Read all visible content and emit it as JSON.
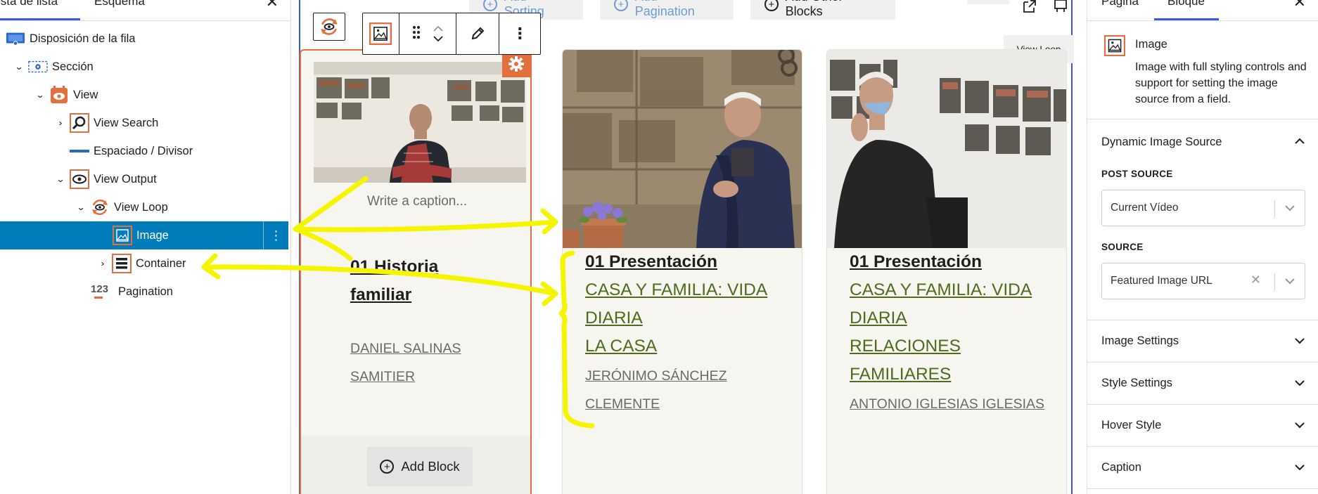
{
  "left_panel": {
    "tabs": [
      "Vista de lista",
      "Esquema"
    ],
    "tree": [
      {
        "label": "Disposición de la fila"
      },
      {
        "label": "Sección"
      },
      {
        "label": "View"
      },
      {
        "label": "View Search"
      },
      {
        "label": "Espaciado / Divisor"
      },
      {
        "label": "View Output"
      },
      {
        "label": "View Loop"
      },
      {
        "label": "Image"
      },
      {
        "label": "Container"
      },
      {
        "label": "Pagination"
      }
    ]
  },
  "canvas": {
    "top_buttons": [
      "Add Sorting",
      "Add Pagination",
      "Add Other Blocks"
    ],
    "view_loop_label": "View Loop",
    "card1": {
      "caption_placeholder": "Write a caption...",
      "title_line1": "01 Historia",
      "title_line2": "familiar",
      "author_line1": "DANIEL SALINAS",
      "author_line2": "SAMITIER",
      "add_block": "Add Block"
    },
    "card2": {
      "title": "01 Presentación",
      "cat_line1": "CASA Y FAMILIA: VIDA",
      "cat_line2": "DIARIA",
      "cat_line3": "LA CASA",
      "author_line1": "JERÓNIMO SÁNCHEZ",
      "author_line2": "CLEMENTE"
    },
    "card3": {
      "title": "01 Presentación",
      "cat_line1": "CASA Y FAMILIA: VIDA",
      "cat_line2": "DIARIA",
      "cat_line3": "RELACIONES",
      "cat_line4": "FAMILIARES",
      "author_line1": "ANTONIO IGLESIAS IGLESIAS"
    }
  },
  "right_panel": {
    "tabs": [
      "Página",
      "Bloque"
    ],
    "block_title": "Image",
    "block_desc": "Image with full styling controls and support for setting the image source from a field.",
    "dynamic_source": "Dynamic Image Source",
    "post_source_label": "POST SOURCE",
    "post_source_value": "Current Vídeo",
    "source_label": "SOURCE",
    "source_value": "Featured Image URL",
    "sections": [
      "Image Settings",
      "Style Settings",
      "Hover Style",
      "Caption"
    ]
  },
  "colors": {
    "accent_orange": "#e26f3c",
    "selection_blue": "#007cba",
    "wp_blue": "#3858e9",
    "category_green": "#4e6b1e",
    "annotation_yellow": "#f5f500"
  }
}
